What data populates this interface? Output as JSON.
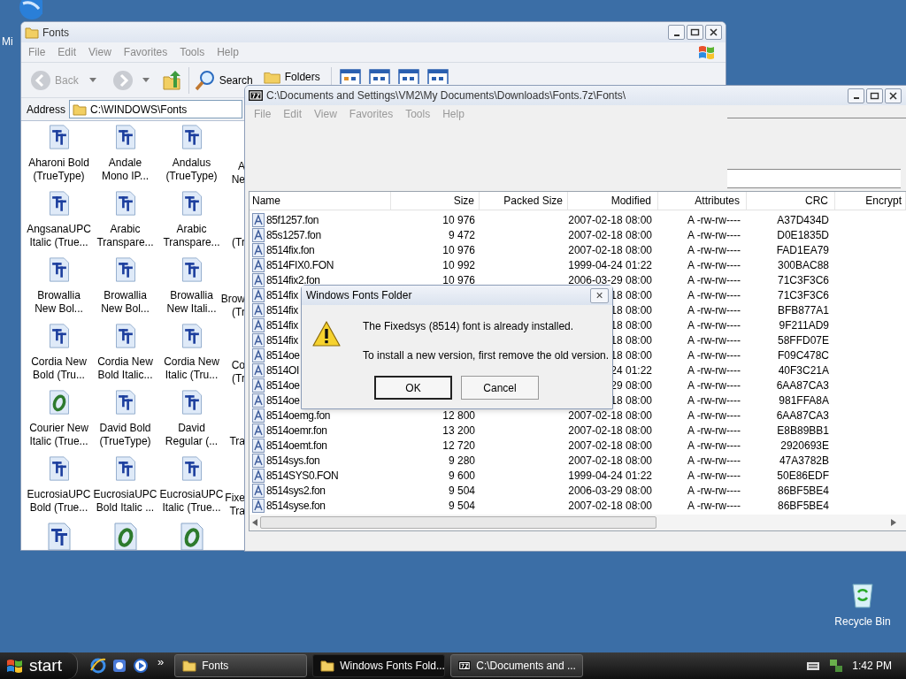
{
  "desktop": {
    "icons": [
      {
        "kind": "globe",
        "label": "Mi"
      },
      {
        "kind": "recycle",
        "label": "Recycle Bin"
      }
    ]
  },
  "fonts_window": {
    "title": "Fonts",
    "menu": [
      "File",
      "Edit",
      "View",
      "Favorites",
      "Tools",
      "Help"
    ],
    "toolbar": {
      "back": {
        "label": "Back",
        "disabled": true
      },
      "search": "Search",
      "folders": "Folders"
    },
    "address": {
      "label": "Address",
      "value": "C:\\WINDOWS\\Fonts"
    },
    "rows": [
      {
        "items": [
          {
            "kind": "truetype",
            "line1": "Aharoni Bold",
            "line2": "(TrueType)"
          },
          {
            "kind": "truetype",
            "line1": "Andale",
            "line2": "Mono IP..."
          },
          {
            "kind": "truetype",
            "line1": "Andalus",
            "line2": "(TrueType)"
          }
        ],
        "cut": {
          "line1": "A",
          "line2": "Ne"
        }
      },
      {
        "items": [
          {
            "kind": "truetype",
            "line1": "AngsanaUPC",
            "line2": "Italic (True..."
          },
          {
            "kind": "truetype",
            "line1": "Arabic",
            "line2": "Transpare..."
          },
          {
            "kind": "truetype",
            "line1": "Arabic",
            "line2": "Transpare..."
          }
        ],
        "cut": {
          "line2": "(Tr"
        }
      },
      {
        "items": [
          {
            "kind": "truetype",
            "line1": "Browallia",
            "line2": "New Bol..."
          },
          {
            "kind": "truetype",
            "line1": "Browallia",
            "line2": "New Bol..."
          },
          {
            "kind": "truetype",
            "line1": "Browallia",
            "line2": "New Itali..."
          }
        ],
        "cut": {
          "line1": "Brow",
          "line2": "(Tr"
        }
      },
      {
        "items": [
          {
            "kind": "truetype",
            "line1": "Cordia New",
            "line2": "Bold (Tru..."
          },
          {
            "kind": "truetype",
            "line1": "Cordia New",
            "line2": "Bold Italic..."
          },
          {
            "kind": "truetype",
            "line1": "Cordia New",
            "line2": "Italic (Tru..."
          }
        ],
        "cut": {
          "line1": "Co",
          "line2": "(Tr"
        }
      },
      {
        "items": [
          {
            "kind": "opentype",
            "line1": "Courier New",
            "line2": "Italic (True..."
          },
          {
            "kind": "truetype",
            "line1": "David Bold",
            "line2": "(TrueType)"
          },
          {
            "kind": "truetype",
            "line1": "David",
            "line2": "Regular (..."
          }
        ],
        "cut": {
          "line2": "Tra"
        }
      },
      {
        "items": [
          {
            "kind": "truetype",
            "line1": "EucrosiaUPC",
            "line2": "Bold (True..."
          },
          {
            "kind": "truetype",
            "line1": "EucrosiaUPC",
            "line2": "Bold Italic ..."
          },
          {
            "kind": "truetype",
            "line1": "EucrosiaUPC",
            "line2": "Italic (True..."
          }
        ],
        "cut": {
          "line1": "Fixe",
          "line2": "Tra"
        }
      },
      {
        "items": [
          {
            "kind": "truetype"
          },
          {
            "kind": "opentype"
          },
          {
            "kind": "opentype"
          }
        ]
      }
    ]
  },
  "archive_window": {
    "title": "C:\\Documents and Settings\\VM2\\My Documents\\Downloads\\Fonts.7z\\Fonts\\",
    "menu": [
      "File",
      "Edit",
      "View",
      "Favorites",
      "Tools",
      "Help"
    ],
    "columns": [
      "Name",
      "Size",
      "Packed Size",
      "Modified",
      "Attributes",
      "CRC",
      "Encrypt"
    ],
    "rows": [
      {
        "name": "85f1257.fon",
        "size": "10 976",
        "modified": "2007-02-18 08:00",
        "attributes": "A -rw-rw----",
        "crc": "A37D434D"
      },
      {
        "name": "85s1257.fon",
        "size": "9 472",
        "modified": "2007-02-18 08:00",
        "attributes": "A -rw-rw----",
        "crc": "D0E1835D"
      },
      {
        "name": "8514fix.fon",
        "size": "10 976",
        "modified": "2007-02-18 08:00",
        "attributes": "A -rw-rw----",
        "crc": "FAD1EA79"
      },
      {
        "name": "8514FIX0.FON",
        "size": "10 992",
        "modified": "1999-04-24 01:22",
        "attributes": "A -rw-rw----",
        "crc": "300BAC88"
      },
      {
        "name": "8514fix2.fon",
        "size": "10 976",
        "modified": "2006-03-29 08:00",
        "attributes": "A -rw-rw----",
        "crc": "71C3F3C6"
      },
      {
        "name": "8514fix",
        "modified": "18 08:00",
        "attributes": "A -rw-rw----",
        "crc": "71C3F3C6"
      },
      {
        "name": "8514fix",
        "modified": "18 08:00",
        "attributes": "A -rw-rw----",
        "crc": "BFB877A1"
      },
      {
        "name": "8514fix",
        "modified": "18 08:00",
        "attributes": "A -rw-rw----",
        "crc": "9F211AD9"
      },
      {
        "name": "8514fix",
        "modified": "18 08:00",
        "attributes": "A -rw-rw----",
        "crc": "58FFD07E"
      },
      {
        "name": "8514oe",
        "modified": "18 08:00",
        "attributes": "A -rw-rw----",
        "crc": "F09C478C"
      },
      {
        "name": "8514OI",
        "modified": "24 01:22",
        "attributes": "A -rw-rw----",
        "crc": "40F3C21A"
      },
      {
        "name": "8514oe",
        "modified": "29 08:00",
        "attributes": "A -rw-rw----",
        "crc": "6AA87CA3"
      },
      {
        "name": "8514oe",
        "modified": "18 08:00",
        "attributes": "A -rw-rw----",
        "crc": "981FFA8A"
      },
      {
        "name": "8514oemg.fon",
        "size": "12 800",
        "modified": "2007-02-18 08:00",
        "attributes": "A -rw-rw----",
        "crc": "6AA87CA3"
      },
      {
        "name": "8514oemr.fon",
        "size": "13 200",
        "modified": "2007-02-18 08:00",
        "attributes": "A -rw-rw----",
        "crc": "E8B89BB1"
      },
      {
        "name": "8514oemt.fon",
        "size": "12 720",
        "modified": "2007-02-18 08:00",
        "attributes": "A -rw-rw----",
        "crc": "2920693E"
      },
      {
        "name": "8514sys.fon",
        "size": "9 280",
        "modified": "2007-02-18 08:00",
        "attributes": "A -rw-rw----",
        "crc": "47A3782B"
      },
      {
        "name": "8514SYS0.FON",
        "size": "9 600",
        "modified": "1999-04-24 01:22",
        "attributes": "A -rw-rw----",
        "crc": "50E86EDF"
      },
      {
        "name": "8514sys2.fon",
        "size": "9 504",
        "modified": "2006-03-29 08:00",
        "attributes": "A -rw-rw----",
        "crc": "86BF5BE4"
      },
      {
        "name": "8514syse.fon",
        "size": "9 504",
        "modified": "2007-02-18 08:00",
        "attributes": "A -rw-rw----",
        "crc": "86BF5BE4"
      }
    ]
  },
  "dialog": {
    "title": "Windows Fonts Folder",
    "close": "×",
    "messages": [
      "The Fixedsys (8514) font is already installed.",
      "To install a new version, first remove the old version."
    ],
    "buttons": [
      {
        "label": "OK",
        "default": true
      },
      {
        "label": "Cancel",
        "default": false
      }
    ]
  },
  "taskbar": {
    "start": "start",
    "more": "»",
    "tasks": [
      {
        "kind": "folder",
        "label": "Fonts",
        "selected": false
      },
      {
        "kind": "folder",
        "label": "Windows Fonts Fold...",
        "selected": true
      },
      {
        "kind": "archive",
        "label": "C:\\Documents and ...",
        "selected": false
      }
    ],
    "clock": "1:42 PM"
  }
}
